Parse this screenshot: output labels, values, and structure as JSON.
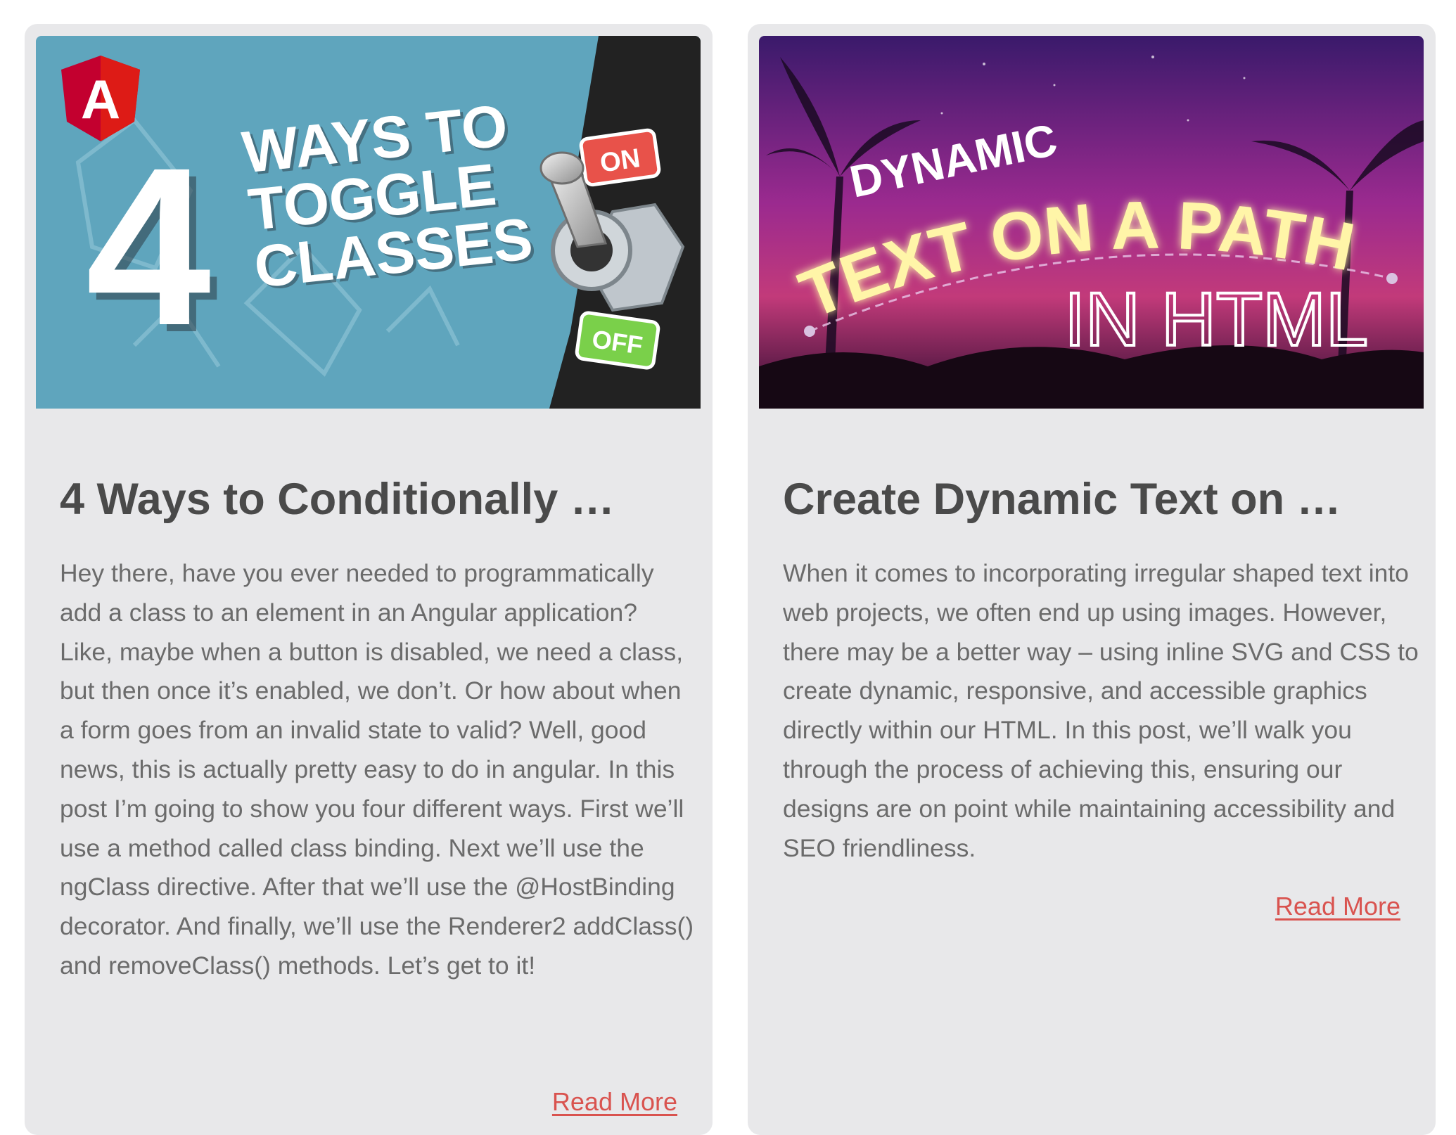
{
  "colors": {
    "card_bg": "#e8e8ea",
    "title": "#4a4a4a",
    "body_text": "#6b6b6b",
    "link": "#d9534f"
  },
  "posts": [
    {
      "image": {
        "number": "4",
        "line1": "WAYS TO",
        "line2": "TOGGLE",
        "line3": "CLASSES",
        "switch_on": "ON",
        "switch_off": "OFF",
        "logo_letter": "A"
      },
      "title": "4 Ways to Conditionally …",
      "excerpt": "Hey there, have you ever needed to programmatically add a class to an element in an Angular application? Like, maybe when a button is disabled, we need a class, but then once it’s enabled, we don’t. Or how about when a form goes from an invalid state to valid? Well, good news, this is actually pretty easy to do in angular. In this post I’m going to show you four different ways. First we’ll use a method called class binding. Next we’ll use the ngClass directive. After that we’ll use the @HostBinding decorator. And finally, we’ll use the Renderer2 addClass() and removeClass() methods. Let’s get to it!",
      "read_more": "Read More"
    },
    {
      "image": {
        "line1": "DYNAMIC",
        "line2": "TEXT ON A PATH",
        "line3": "IN HTML"
      },
      "title": "Create Dynamic Text on …",
      "excerpt": "When it comes to incorporating irregular shaped text into web projects, we often end up using images. However, there may be a better way – using inline SVG and CSS to create dynamic, responsive, and accessible graphics directly within our HTML. In this post, we’ll walk you through the process of achieving this, ensuring our designs are on point while maintaining accessibility and SEO friendliness.",
      "read_more": "Read More"
    }
  ]
}
